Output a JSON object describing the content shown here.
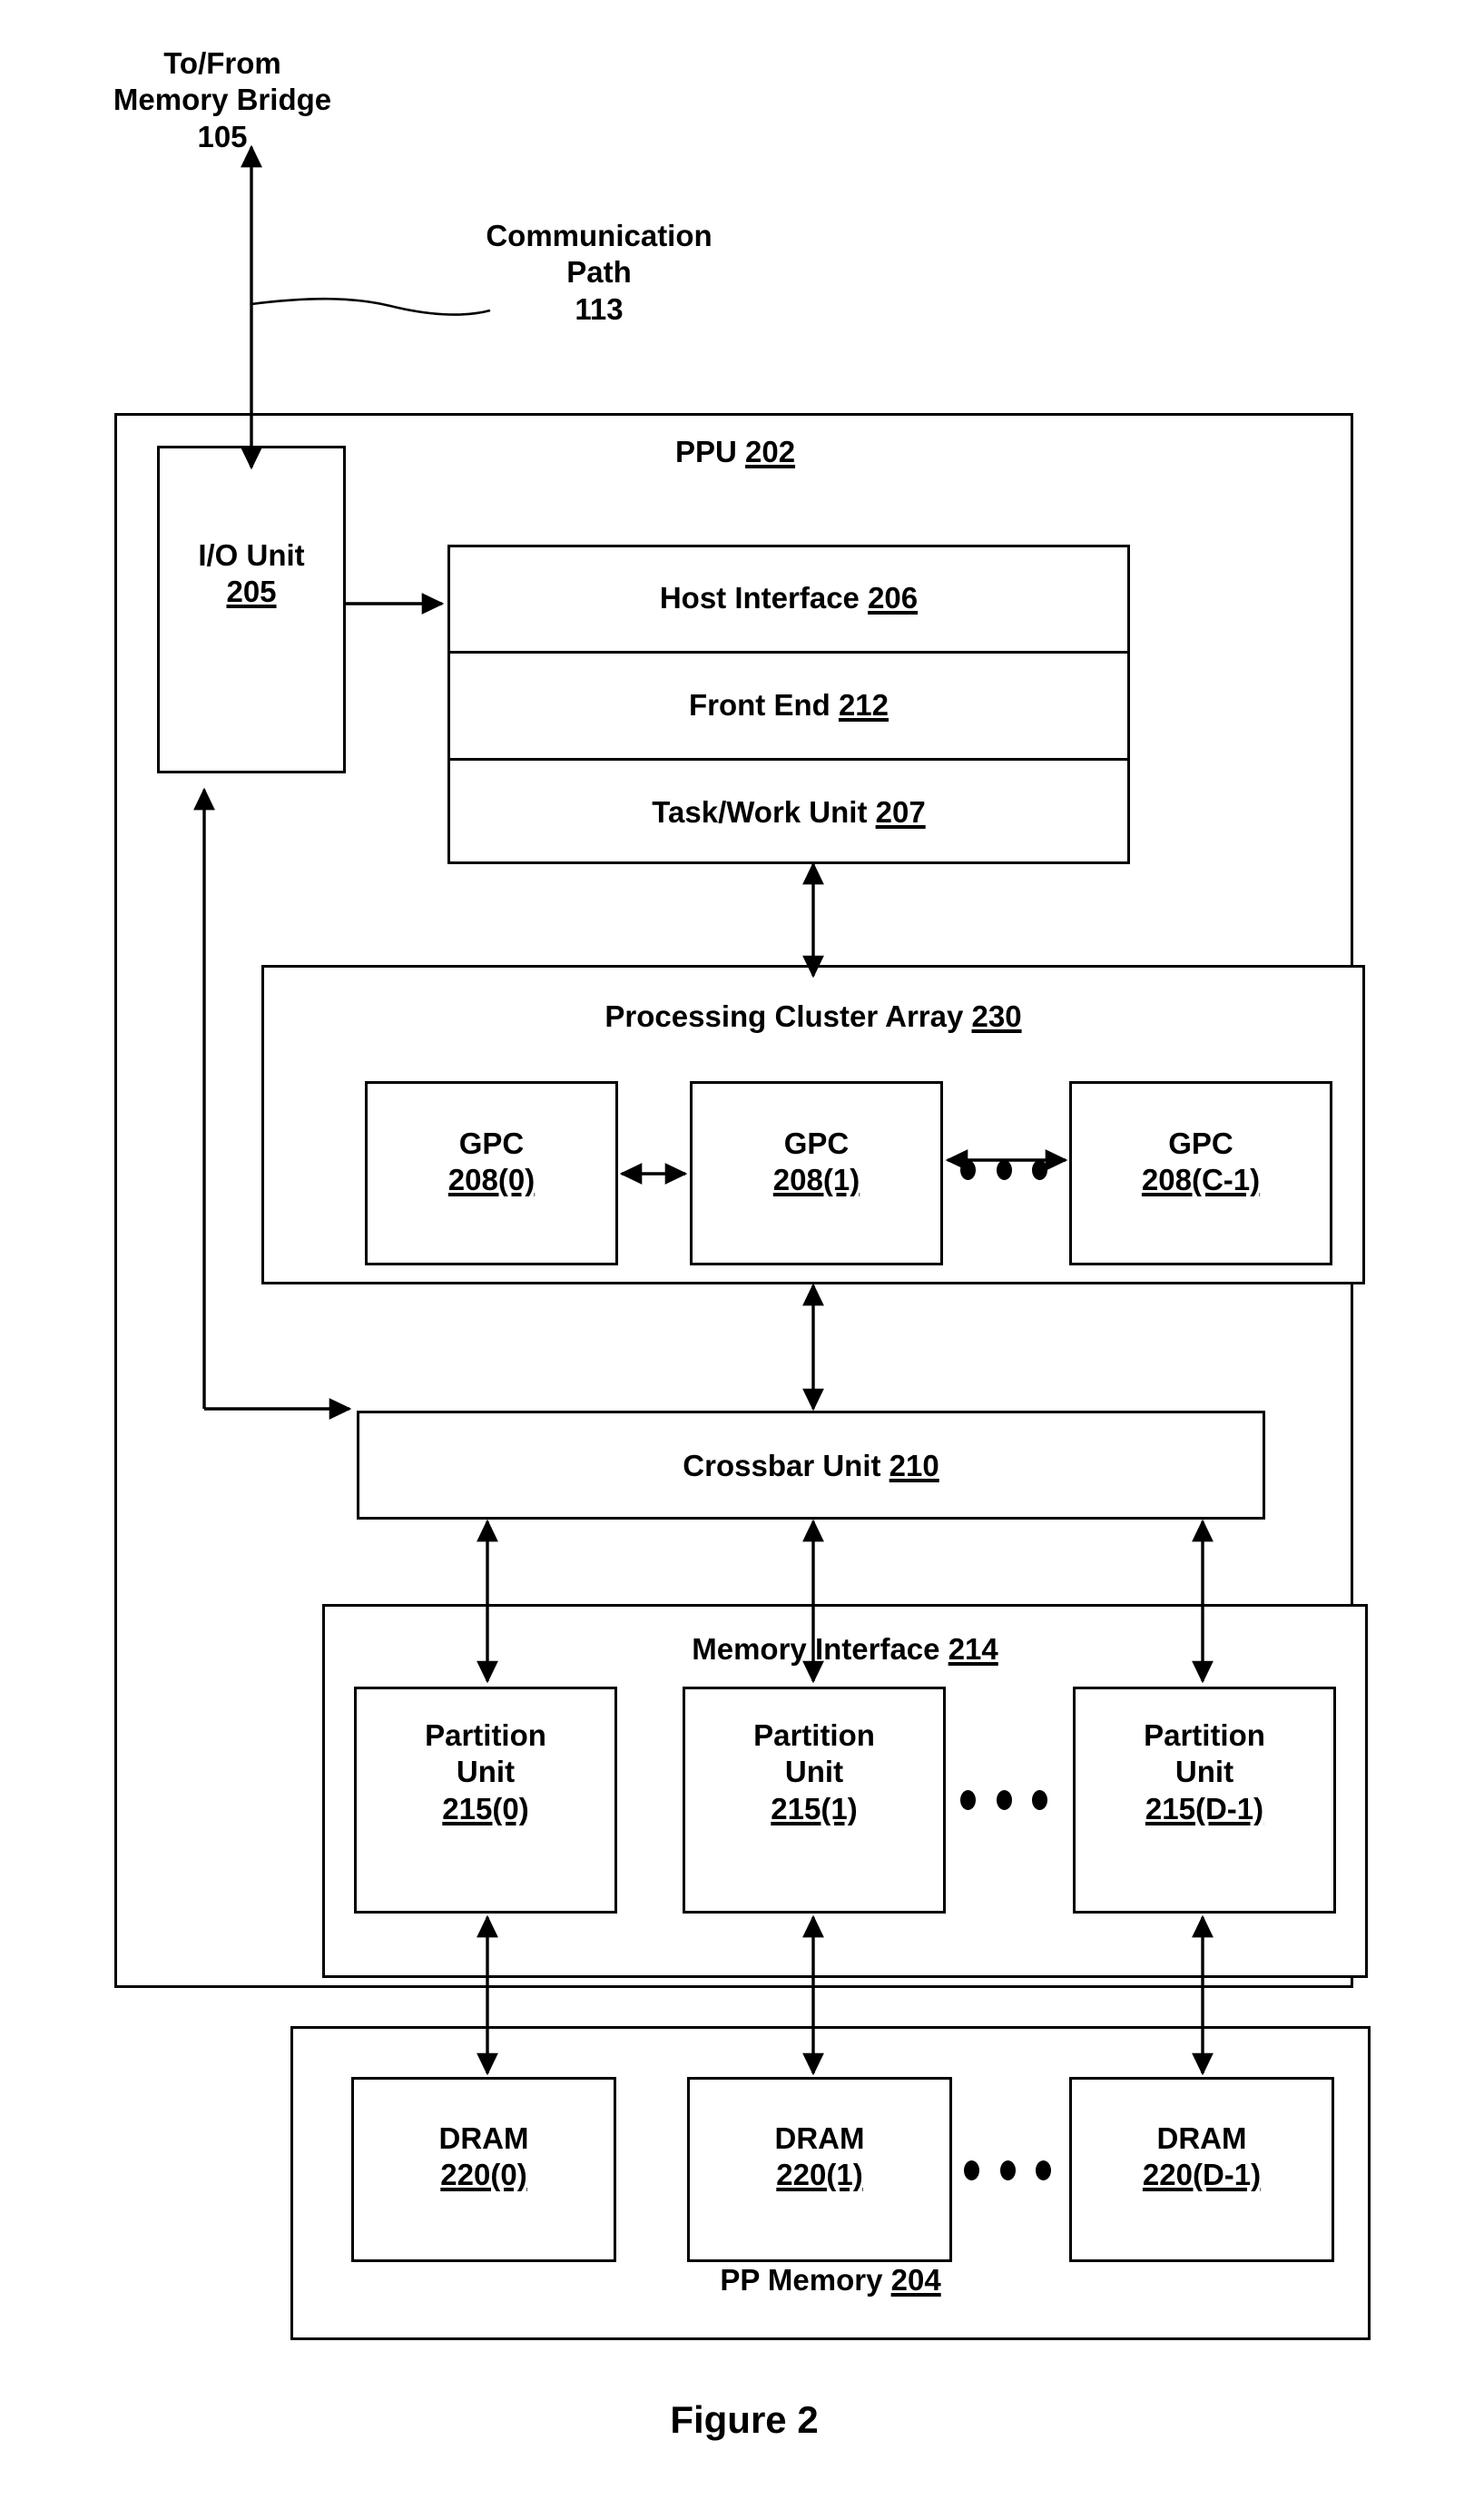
{
  "figure": {
    "caption": "Figure 2"
  },
  "annotations": {
    "memory_bridge": "To/From\nMemory Bridge\n105",
    "communication_path": "Communication\nPath\n113"
  },
  "ppu": {
    "title_text": "PPU ",
    "title_ref": "202"
  },
  "io_unit": {
    "name": "I/O Unit",
    "ref": "205"
  },
  "front_stack": [
    {
      "name": "Host Interface ",
      "ref": "206"
    },
    {
      "name": "Front End ",
      "ref": "212"
    },
    {
      "name": "Task/Work Unit ",
      "ref": "207"
    }
  ],
  "processing_cluster_array": {
    "title_text": "Processing Cluster Array ",
    "title_ref": "230",
    "gpcs": [
      {
        "name": "GPC",
        "ref": "208(0)"
      },
      {
        "name": "GPC",
        "ref": "208(1)"
      },
      {
        "name": "GPC",
        "ref": "208(C-1)"
      }
    ],
    "ellipsis": "• • •"
  },
  "crossbar": {
    "name": "Crossbar Unit ",
    "ref": "210"
  },
  "memory_interface": {
    "title_text": "Memory Interface ",
    "title_ref": "214",
    "partitions": [
      {
        "name": "Partition\nUnit",
        "ref": "215(0)"
      },
      {
        "name": "Partition\nUnit",
        "ref": "215(1)"
      },
      {
        "name": "Partition\nUnit",
        "ref": "215(D-1)"
      }
    ]
  },
  "pp_memory": {
    "title_text": "PP Memory ",
    "title_ref": "204",
    "drams": [
      {
        "name": "DRAM",
        "ref": "220(0)"
      },
      {
        "name": "DRAM",
        "ref": "220(1)"
      },
      {
        "name": "DRAM",
        "ref": "220(D-1)"
      }
    ]
  }
}
